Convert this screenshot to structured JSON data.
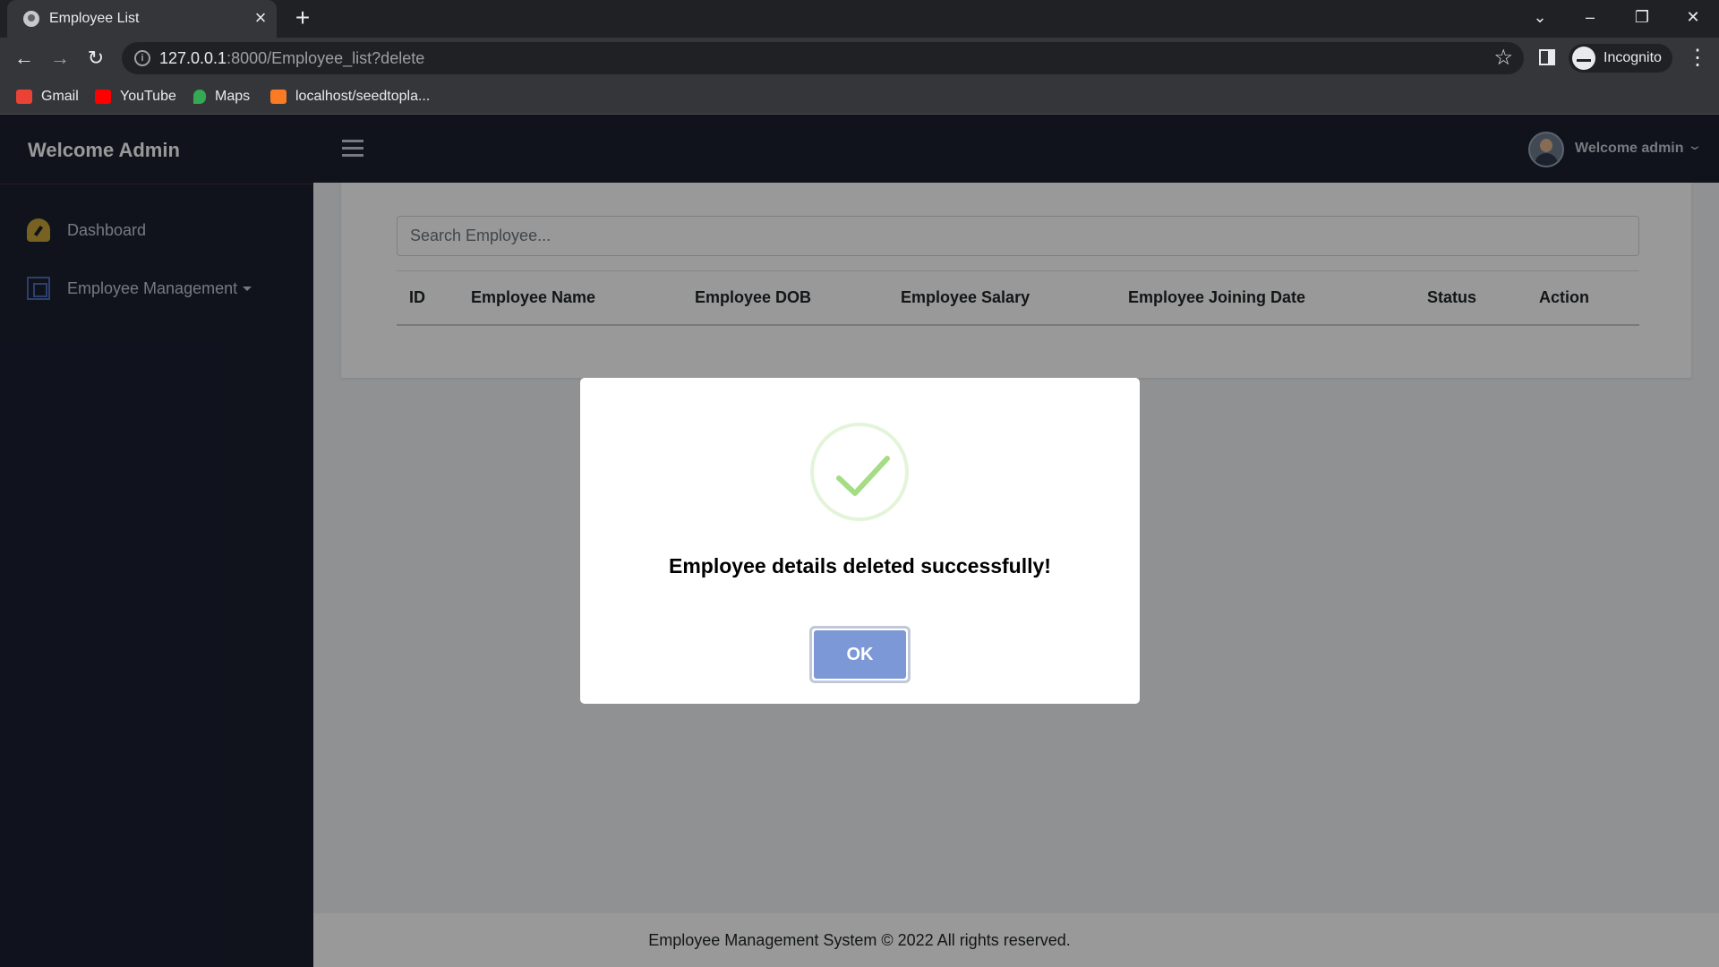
{
  "browser": {
    "tab_title": "Employee List",
    "url_host": "127.0.0.1",
    "url_rest": ":8000/Employee_list?delete",
    "incognito_label": "Incognito",
    "bookmarks": [
      {
        "label": "Gmail",
        "icon": "gmail-icon",
        "color": "#ea4335"
      },
      {
        "label": "YouTube",
        "icon": "youtube-icon",
        "color": "#ff0000"
      },
      {
        "label": "Maps",
        "icon": "maps-icon",
        "color": "#34a853"
      },
      {
        "label": "localhost/seedtopla...",
        "icon": "xampp-icon",
        "color": "#fb7a24"
      }
    ]
  },
  "sidebar": {
    "brand": "Welcome Admin",
    "items": [
      {
        "label": "Dashboard",
        "icon": "dashboard-gauge-icon"
      },
      {
        "label": "Employee Management",
        "icon": "employee-management-icon"
      }
    ]
  },
  "topbar": {
    "user_label": "Welcome admin"
  },
  "main": {
    "search_placeholder": "Search Employee...",
    "table_headers": [
      "ID",
      "Employee Name",
      "Employee DOB",
      "Employee Salary",
      "Employee Joining Date",
      "Status",
      "Action"
    ]
  },
  "footer": {
    "text": "Employee Management System © 2022 All rights reserved."
  },
  "modal": {
    "title": "Employee details deleted successfully!",
    "ok_label": "OK",
    "icon": "success-check-icon",
    "accent_color": "#7d98d6",
    "check_color": "#a5dc86"
  }
}
